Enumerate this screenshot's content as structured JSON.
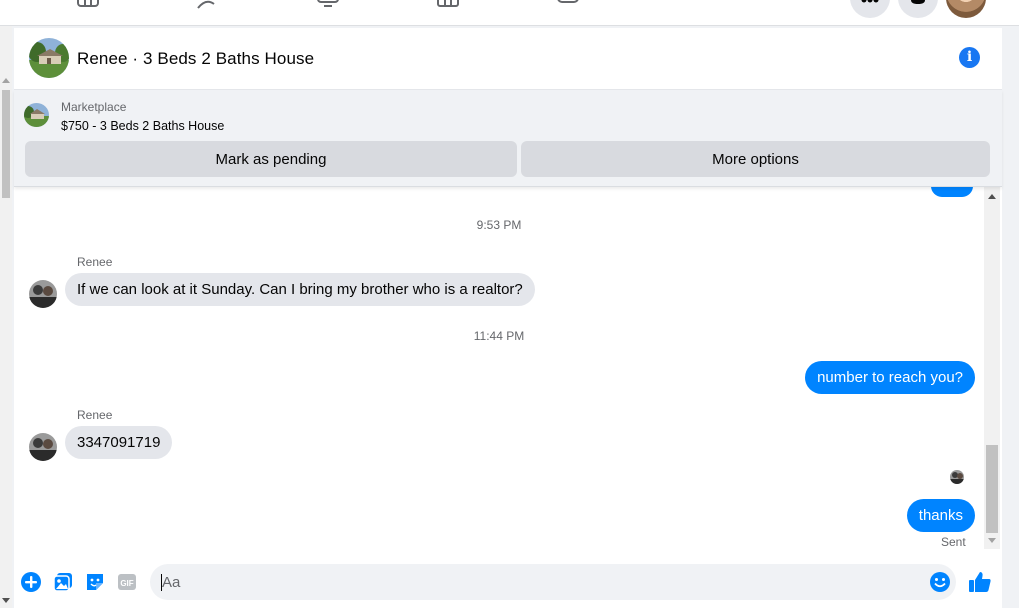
{
  "colors": {
    "accent": "#1877f2",
    "outgoing_bubble": "#0084ff",
    "incoming_bubble": "#e4e6eb",
    "secondary_text": "#65676b",
    "panel_bg": "#f0f2f5"
  },
  "topnav": {
    "icons": [
      "watch-icon",
      "friends-icon",
      "gaming-tv-icon",
      "marketplace-icon",
      "groups-icon"
    ],
    "right_buttons": [
      "menu-grid-icon",
      "notifications-icon",
      "profile-avatar"
    ]
  },
  "header": {
    "title": "Renee · 3 Beds 2 Baths House",
    "info_icon": "info-icon"
  },
  "marketplace": {
    "label": "Marketplace",
    "listing": "$750 - 3 Beds 2 Baths House",
    "buttons": {
      "pending": "Mark as pending",
      "more": "More options"
    }
  },
  "messages": [
    {
      "type": "timestamp",
      "text": "9:53 PM"
    },
    {
      "type": "sender",
      "text": "Renee"
    },
    {
      "type": "incoming",
      "text": "If we can look at it Sunday. Can I bring my brother who is a realtor?"
    },
    {
      "type": "timestamp",
      "text": "11:44 PM"
    },
    {
      "type": "outgoing",
      "text": "number to reach you?"
    },
    {
      "type": "sender",
      "text": "Renee"
    },
    {
      "type": "incoming",
      "text": "3347091719"
    },
    {
      "type": "outgoing",
      "text": "thanks"
    },
    {
      "type": "status",
      "text": "Sent"
    }
  ],
  "composer": {
    "placeholder": "Aa",
    "value": "",
    "icons": [
      "add-icon",
      "photo-icon",
      "sticker-icon",
      "gif-icon",
      "emoji-icon",
      "like-icon"
    ],
    "gif_label": "GIF"
  }
}
